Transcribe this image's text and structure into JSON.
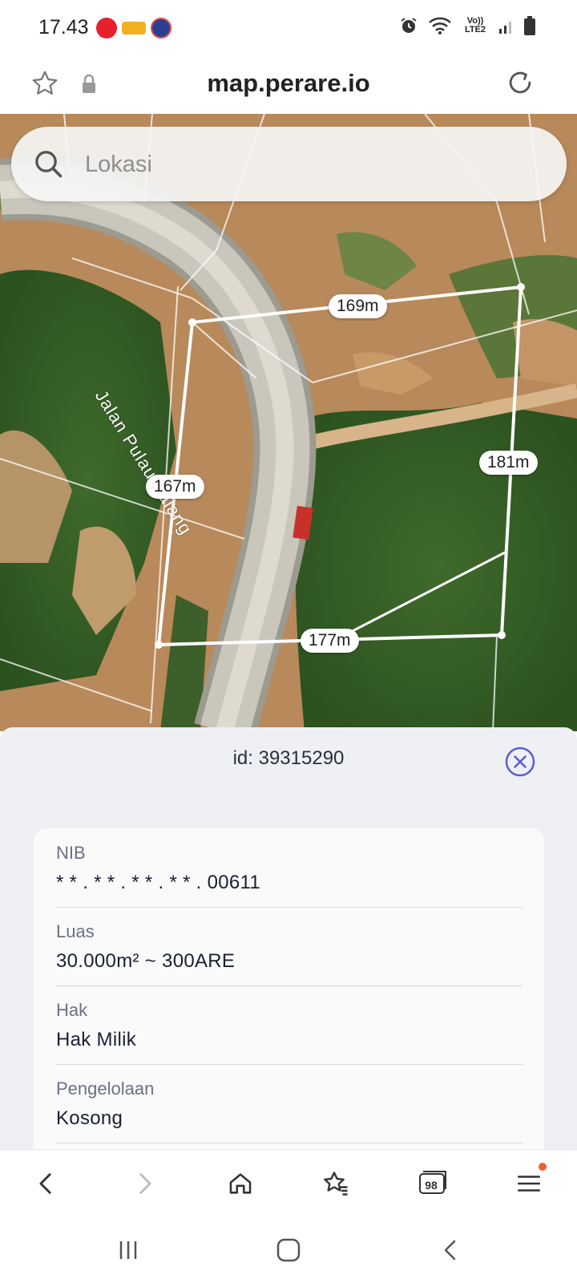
{
  "status_bar": {
    "time": "17.43",
    "network": "Vo)) LTE2",
    "icons": [
      "alarm-icon",
      "wifi-icon",
      "signal-icon",
      "battery-icon"
    ]
  },
  "browser": {
    "url": "map.perare.io",
    "icons": [
      "star-icon",
      "lock-icon",
      "reload-icon"
    ]
  },
  "map": {
    "search_placeholder": "Lokasi",
    "road_name": "Jalan Pulau Balang",
    "dimensions": [
      "169m",
      "181m",
      "167m",
      "177m"
    ],
    "parcel_line_color": "#ffffff"
  },
  "sheet": {
    "id_text": "id: 39315290",
    "accent_color": "#5b5bd6",
    "fields": [
      {
        "label": "NIB",
        "value": "* * . * * . * * . * * . 00611"
      },
      {
        "label": "Luas",
        "value": "30.000m² ~ 300ARE"
      },
      {
        "label": "Hak",
        "value": "Hak Milik"
      },
      {
        "label": "Pengelolaan",
        "value": "Kosong"
      }
    ]
  },
  "bottom_nav": {
    "tab_count": "98",
    "icons": [
      "back-icon",
      "forward-icon",
      "home-icon",
      "bookmarks-icon",
      "tabs-icon",
      "menu-icon"
    ]
  },
  "system_nav": {
    "icons": [
      "recents-icon",
      "home-circle-icon",
      "system-back-icon"
    ]
  }
}
